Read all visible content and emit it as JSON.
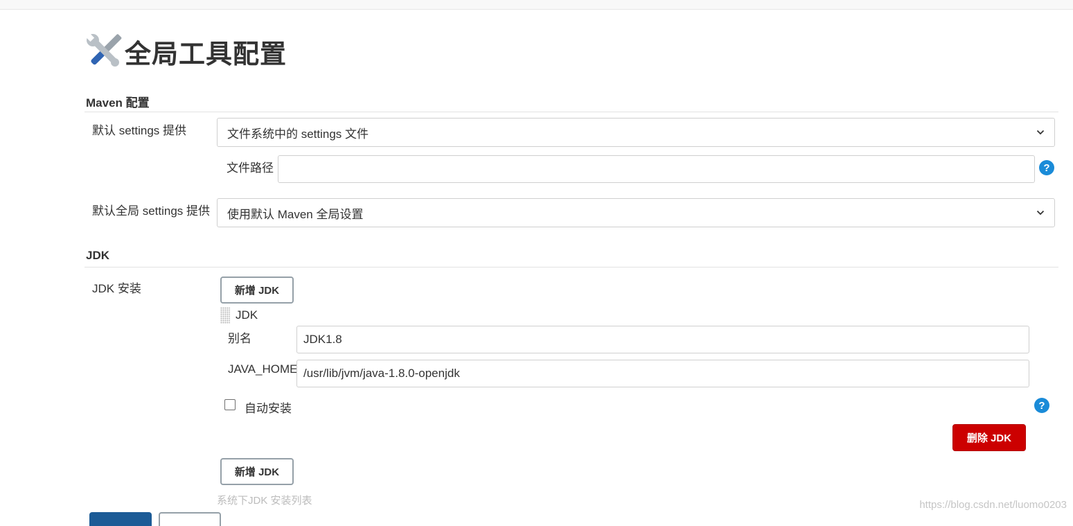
{
  "page": {
    "title": "全局工具配置"
  },
  "maven": {
    "heading": "Maven 配置",
    "default_settings_label": "默认 settings 提供",
    "default_settings_value": "文件系统中的 settings 文件",
    "file_path_label": "文件路径",
    "file_path_value": "",
    "help": "?",
    "global_settings_label": "默认全局 settings 提供",
    "global_settings_value": "使用默认 Maven 全局设置"
  },
  "jdk": {
    "heading": "JDK",
    "install_label": "JDK 安装",
    "add_button": "新增 JDK",
    "item_title": "JDK",
    "alias_label": "别名",
    "alias_value": "JDK1.8",
    "java_home_label": "JAVA_HOME",
    "java_home_value": "/usr/lib/jvm/java-1.8.0-openjdk",
    "auto_install_label": "自动安装",
    "auto_install_checked": false,
    "help": "?",
    "delete_button": "删除 JDK",
    "add_button_2": "新增 JDK",
    "cutoff_text": "系统下JDK 安装列表"
  },
  "watermark": "https://blog.csdn.net/luomo0203",
  "colors": {
    "primary": "#1c5b96",
    "danger": "#cc0000",
    "help": "#1a8bd8"
  }
}
